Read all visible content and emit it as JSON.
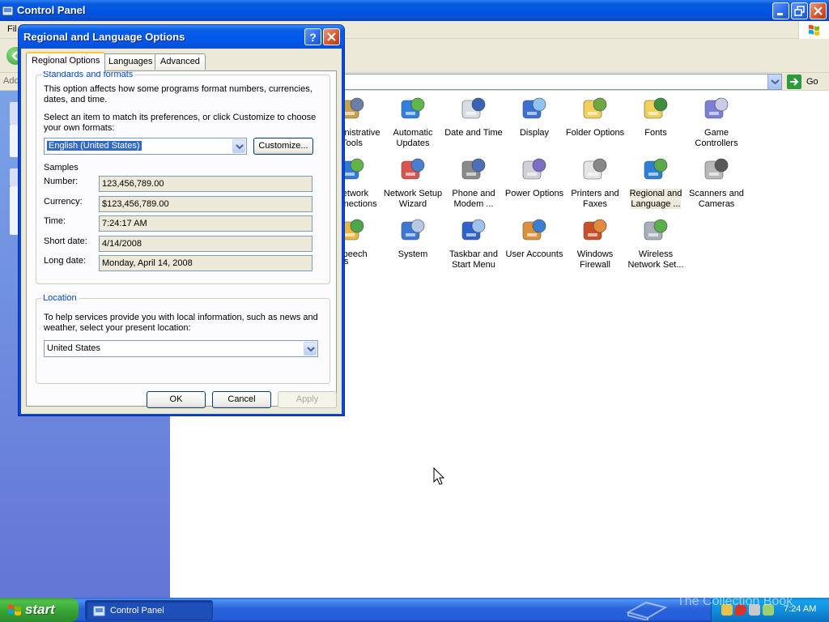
{
  "window": {
    "title": "Control Panel",
    "menu": [
      "Fil"
    ],
    "address_label": "Add",
    "go_label": "Go"
  },
  "control_panel_items": [
    {
      "label": "Administrative Tools",
      "icon": "admin-tools-icon",
      "selected": false
    },
    {
      "label": "Automatic Updates",
      "icon": "automatic-updates-icon",
      "selected": false
    },
    {
      "label": "Date and Time",
      "icon": "date-time-icon",
      "selected": false
    },
    {
      "label": "Display",
      "icon": "display-icon",
      "selected": false
    },
    {
      "label": "Folder Options",
      "icon": "folder-options-icon",
      "selected": false
    },
    {
      "label": "Fonts",
      "icon": "fonts-icon",
      "selected": false
    },
    {
      "label": "Game Controllers",
      "icon": "game-controllers-icon",
      "selected": false
    },
    {
      "label": "Network Connections",
      "icon": "network-connections-icon",
      "selected": false
    },
    {
      "label": "Network Setup Wizard",
      "icon": "network-setup-icon",
      "selected": false
    },
    {
      "label": "Phone and Modem ...",
      "icon": "phone-modem-icon",
      "selected": false
    },
    {
      "label": "Power Options",
      "icon": "power-options-icon",
      "selected": false
    },
    {
      "label": "Printers and Faxes",
      "icon": "printers-faxes-icon",
      "selected": false
    },
    {
      "label": "Regional and Language ...",
      "icon": "globe-icon",
      "selected": true
    },
    {
      "label": "Scanners and Cameras",
      "icon": "scanners-cameras-icon",
      "selected": false
    },
    {
      "label": "Speech",
      "icon": "speech-icon",
      "selected": false
    },
    {
      "label": "System",
      "icon": "system-icon",
      "selected": false
    },
    {
      "label": "Taskbar and Start Menu",
      "icon": "taskbar-icon",
      "selected": false
    },
    {
      "label": "User Accounts",
      "icon": "user-accounts-icon",
      "selected": false
    },
    {
      "label": "Windows Firewall",
      "icon": "firewall-icon",
      "selected": false
    },
    {
      "label": "Wireless Network Set...",
      "icon": "wireless-icon",
      "selected": false
    }
  ],
  "partial_item_tail": "s",
  "dialog": {
    "title": "Regional and Language Options",
    "tabs": [
      "Regional Options",
      "Languages",
      "Advanced"
    ],
    "standards": {
      "legend": "Standards and formats",
      "desc": "This option affects how some programs format numbers, currencies, dates, and time.",
      "select_prompt": "Select an item to match its preferences, or click Customize to choose your own formats:",
      "format_value": "English (United States)",
      "customize_label": "Customize...",
      "samples_heading": "Samples",
      "samples": [
        {
          "label": "Number:",
          "value": "123,456,789.00"
        },
        {
          "label": "Currency:",
          "value": "$123,456,789.00"
        },
        {
          "label": "Time:",
          "value": "7:24:17 AM"
        },
        {
          "label": "Short date:",
          "value": "4/14/2008"
        },
        {
          "label": "Long date:",
          "value": "Monday, April 14, 2008"
        }
      ]
    },
    "location": {
      "legend": "Location",
      "desc": "To help services provide you with local information, such as news and weather, select your present location:",
      "value": "United States"
    },
    "buttons": {
      "ok": "OK",
      "cancel": "Cancel",
      "apply": "Apply"
    }
  },
  "taskbar": {
    "start_label": "start",
    "task_label": "Control Panel",
    "clock": "7:24 AM"
  },
  "watermark": "The Collection Book"
}
